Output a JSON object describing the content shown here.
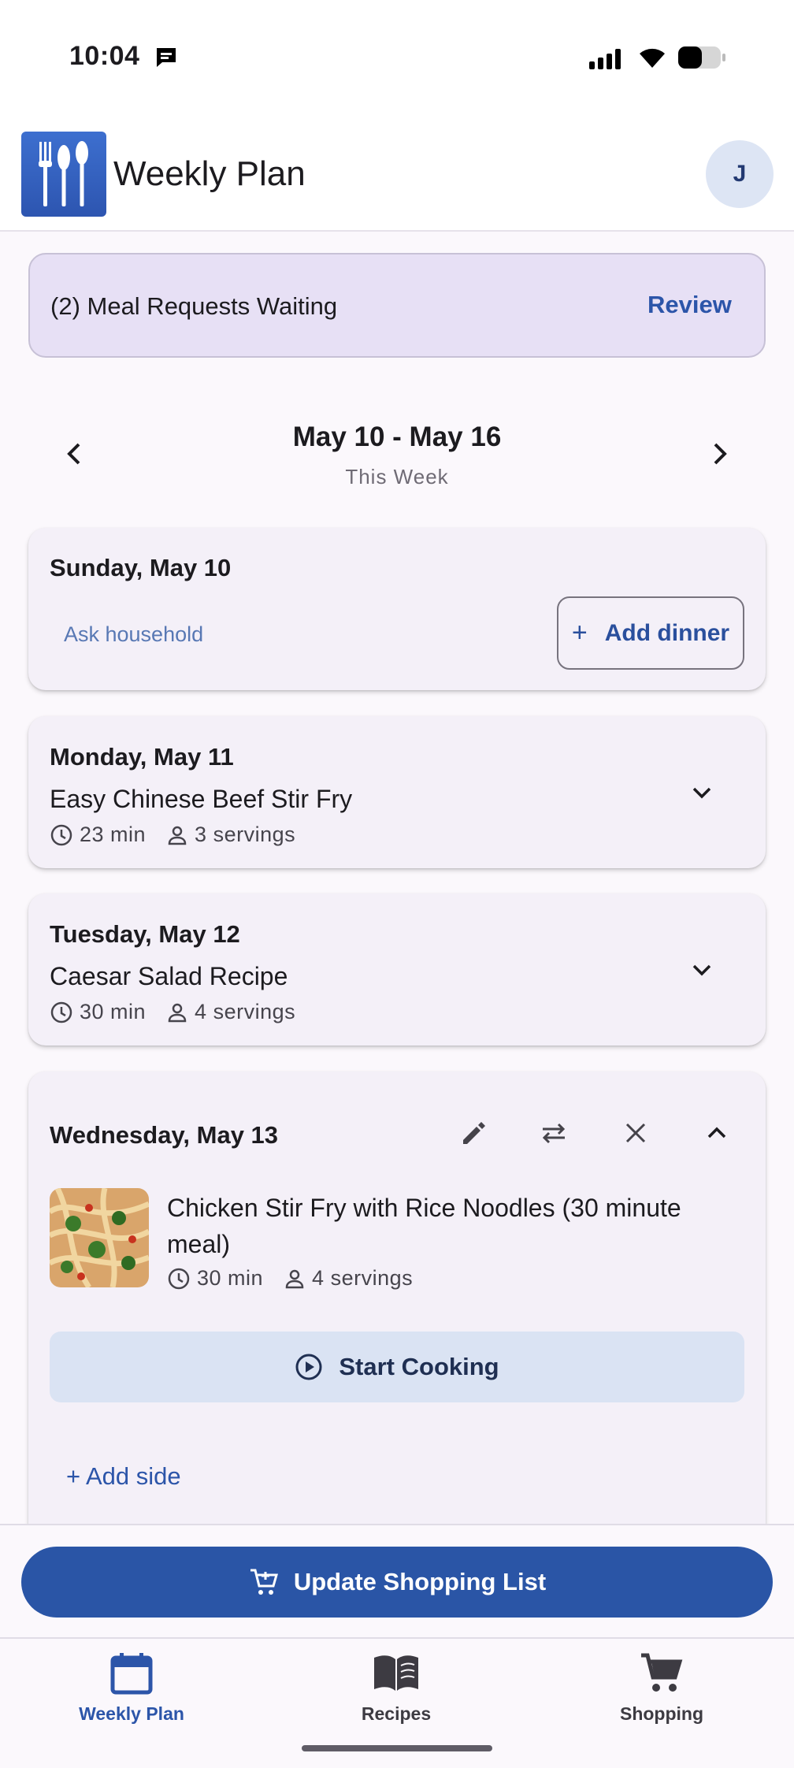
{
  "status_bar": {
    "time": "10:04"
  },
  "header": {
    "title": "Weekly Plan",
    "avatar_initial": "J"
  },
  "request_banner": {
    "text": "(2) Meal Requests Waiting",
    "action": "Review"
  },
  "week_nav": {
    "range": "May 10 - May 16",
    "label": "This Week"
  },
  "days": [
    {
      "title": "Sunday, May 10",
      "ask_link": "Ask household",
      "add_dinner": "Add dinner"
    },
    {
      "title": "Monday, May 11",
      "meal": "Easy Chinese Beef Stir Fry",
      "time": "23 min",
      "servings": "3 servings"
    },
    {
      "title": "Tuesday, May 12",
      "meal": "Caesar Salad Recipe",
      "time": "30 min",
      "servings": "4 servings"
    },
    {
      "title": "Wednesday, May 13",
      "meal": "Chicken Stir Fry with Rice Noodles (30 minute meal)",
      "time": "30 min",
      "servings": "4 servings",
      "start_cooking": "Start Cooking",
      "add_side": "+ Add side"
    }
  ],
  "update_button": "Update Shopping List",
  "tabs": [
    {
      "label": "Weekly Plan",
      "icon": "calendar-icon",
      "active": true
    },
    {
      "label": "Recipes",
      "icon": "book-icon",
      "active": false
    },
    {
      "label": "Shopping",
      "icon": "cart-icon",
      "active": false
    }
  ],
  "colors": {
    "primary": "#2a55a6",
    "banner": "#e7e0f5",
    "card": "#f4f0f8",
    "link": "#2c55a9"
  }
}
